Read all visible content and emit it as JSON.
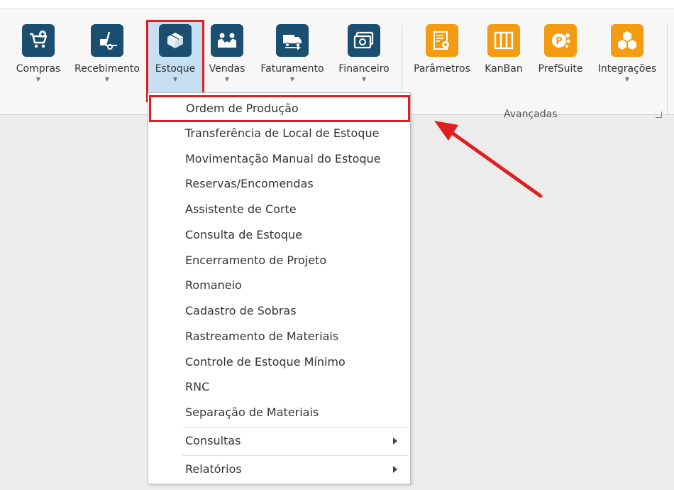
{
  "ribbon": {
    "buttons": [
      {
        "id": "compras",
        "label": "Compras",
        "icon": "cart-icon",
        "dropdown": true
      },
      {
        "id": "recebimento",
        "label": "Recebimento",
        "icon": "hand-truck-icon",
        "dropdown": true
      },
      {
        "id": "estoque",
        "label": "Estoque",
        "icon": "boxes-icon",
        "dropdown": true
      },
      {
        "id": "vendas",
        "label": "Vendas",
        "icon": "handshake-icon",
        "dropdown": true
      },
      {
        "id": "faturamento",
        "label": "Faturamento",
        "icon": "truck-icon",
        "dropdown": true
      },
      {
        "id": "financeiro",
        "label": "Financeiro",
        "icon": "money-icon",
        "dropdown": true
      },
      {
        "id": "parametros",
        "label": "Parâmetros",
        "icon": "settings-sheet-icon",
        "dropdown": false
      },
      {
        "id": "kanban",
        "label": "KanBan",
        "icon": "kanban-icon",
        "dropdown": false
      },
      {
        "id": "prefsuite",
        "label": "PrefSuite",
        "icon": "prefsuite-icon",
        "dropdown": false
      },
      {
        "id": "integracoes",
        "label": "Integrações",
        "icon": "cubes-icon",
        "dropdown": true
      }
    ],
    "group_label": "Avançadas",
    "active_button": "Estoque"
  },
  "menu": {
    "items": [
      {
        "label": "Ordem de Produção",
        "highlighted": true
      },
      {
        "label": "Transferência de Local de Estoque"
      },
      {
        "label": "Movimentação Manual do Estoque"
      },
      {
        "label": "Reservas/Encomendas"
      },
      {
        "label": "Assistente de Corte"
      },
      {
        "label": "Consulta de Estoque"
      },
      {
        "label": "Encerramento de Projeto"
      },
      {
        "label": "Romaneio"
      },
      {
        "label": "Cadastro de Sobras"
      },
      {
        "label": "Rastreamento de Materiais"
      },
      {
        "label": "Controle de Estoque Mínimo"
      },
      {
        "label": "RNC"
      },
      {
        "label": "Separação de Materiais"
      }
    ],
    "submenus": [
      {
        "label": "Consultas"
      },
      {
        "label": "Relatórios"
      }
    ]
  },
  "colors": {
    "ribbon_icon_blue": "#1b4f72",
    "ribbon_icon_orange": "#f39c12",
    "active_bg": "#c6dff3",
    "annotation_red": "#e02020"
  }
}
